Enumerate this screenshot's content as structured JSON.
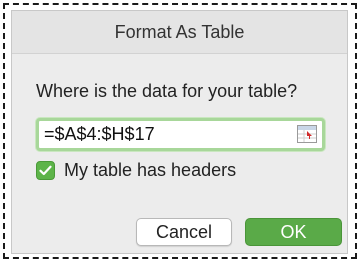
{
  "dialog": {
    "title": "Format As Table",
    "question": "Where is the data for your table?",
    "range_value": "=$A$4:$H$17",
    "headers_checkbox": {
      "label": "My table has headers",
      "checked": true
    },
    "buttons": {
      "cancel": "Cancel",
      "ok": "OK"
    },
    "icons": {
      "collapse": "collapse-dialog-icon",
      "check": "checkmark-icon"
    },
    "colors": {
      "accent_green": "#5aaa48",
      "focus_ring": "#a8d79a"
    }
  }
}
